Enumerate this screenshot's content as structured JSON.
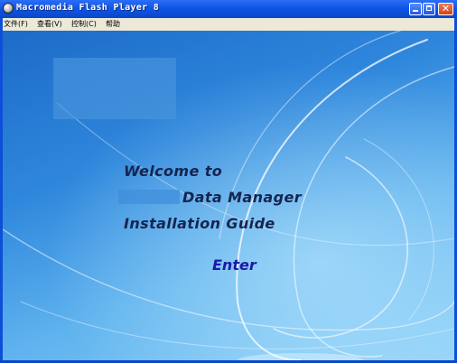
{
  "window": {
    "title": "Macromedia Flash Player 8",
    "controls": {
      "minimize": "minimize-button",
      "maximize": "maximize-button",
      "close": "close-button"
    }
  },
  "menubar": {
    "items": [
      {
        "label": "文件(F)"
      },
      {
        "label": "查看(V)"
      },
      {
        "label": "控制(C)"
      },
      {
        "label": "帮助"
      }
    ]
  },
  "content": {
    "welcome": {
      "line1": "Welcome to",
      "line2": "Data Manager",
      "line3": "Installation Guide"
    },
    "enter_label": "Enter"
  },
  "colors": {
    "titlebar": "#0f55e6",
    "menubar": "#ece9d8",
    "text_dark": "#15254f",
    "enter": "#1a1aa8"
  }
}
